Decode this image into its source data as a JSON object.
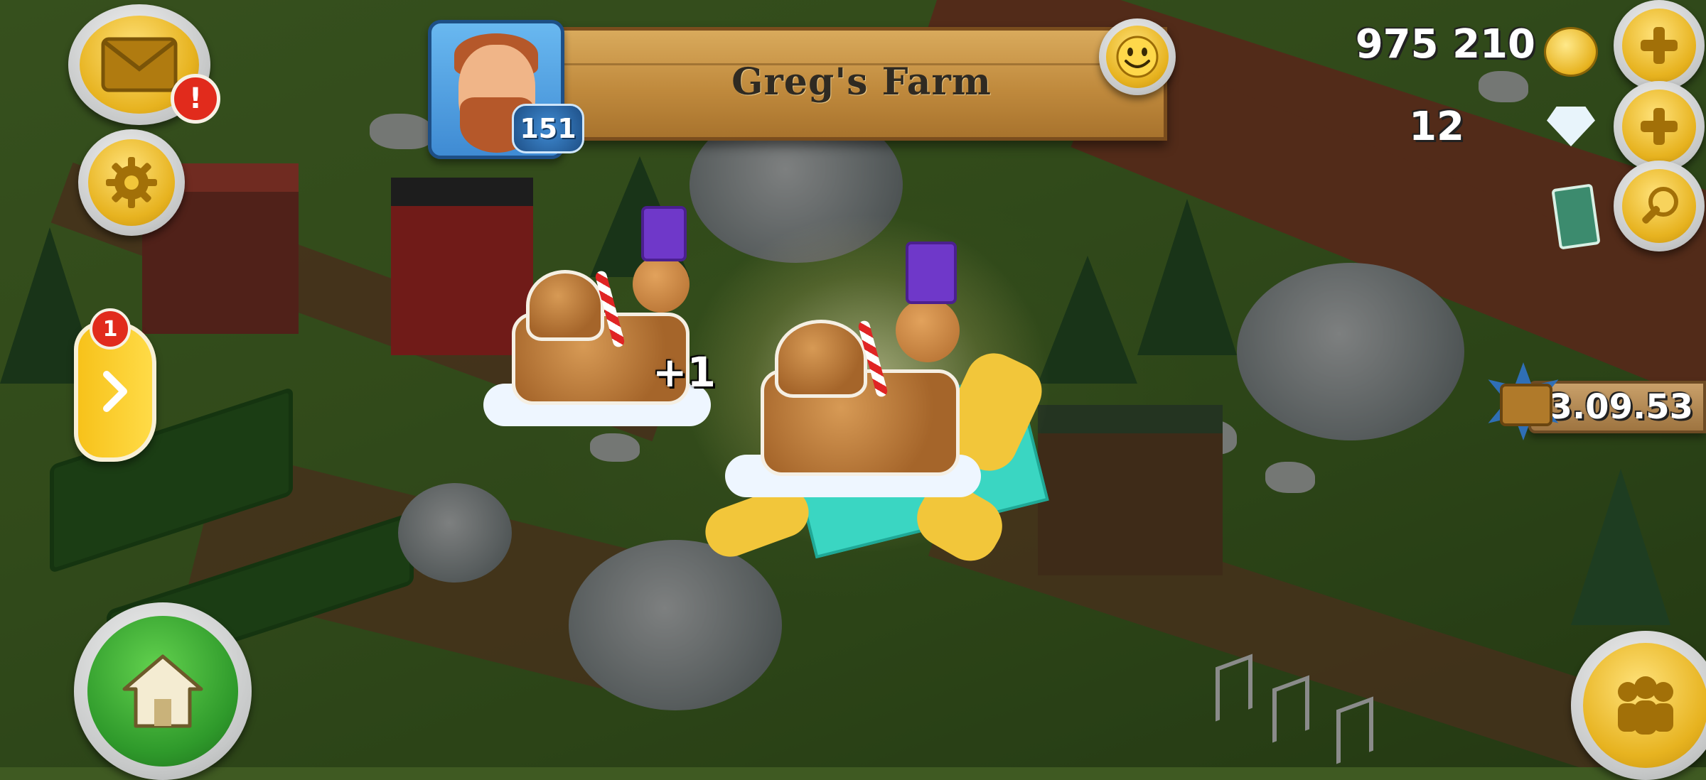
{
  "profile": {
    "farm_name": "Greg's Farm",
    "level": "151"
  },
  "currencies": {
    "coins": "975 210",
    "diamonds": "12"
  },
  "event_timer": "23.09.53",
  "notifications": {
    "mail_alert": "!",
    "side_panel_count": "1"
  },
  "reward": {
    "amount": "+1",
    "item": "gingerbread-train-decoration"
  },
  "icons": {
    "mail": "envelope-icon",
    "settings": "gear-icon",
    "side_tab": "chevron-right-icon",
    "home": "house-icon",
    "friends": "people-icon",
    "add_coins": "plus-icon",
    "add_diamonds": "plus-icon",
    "search": "magnifier-icon",
    "smiley": "smiley-icon",
    "coin": "coin-icon",
    "diamond": "diamond-icon",
    "timer": "treasure-chest-icon"
  },
  "colors": {
    "hud_gold": "#e7b320",
    "alert_red": "#e12b1c",
    "home_green": "#2f9a2b",
    "banner_wood": "#c08a3d"
  }
}
